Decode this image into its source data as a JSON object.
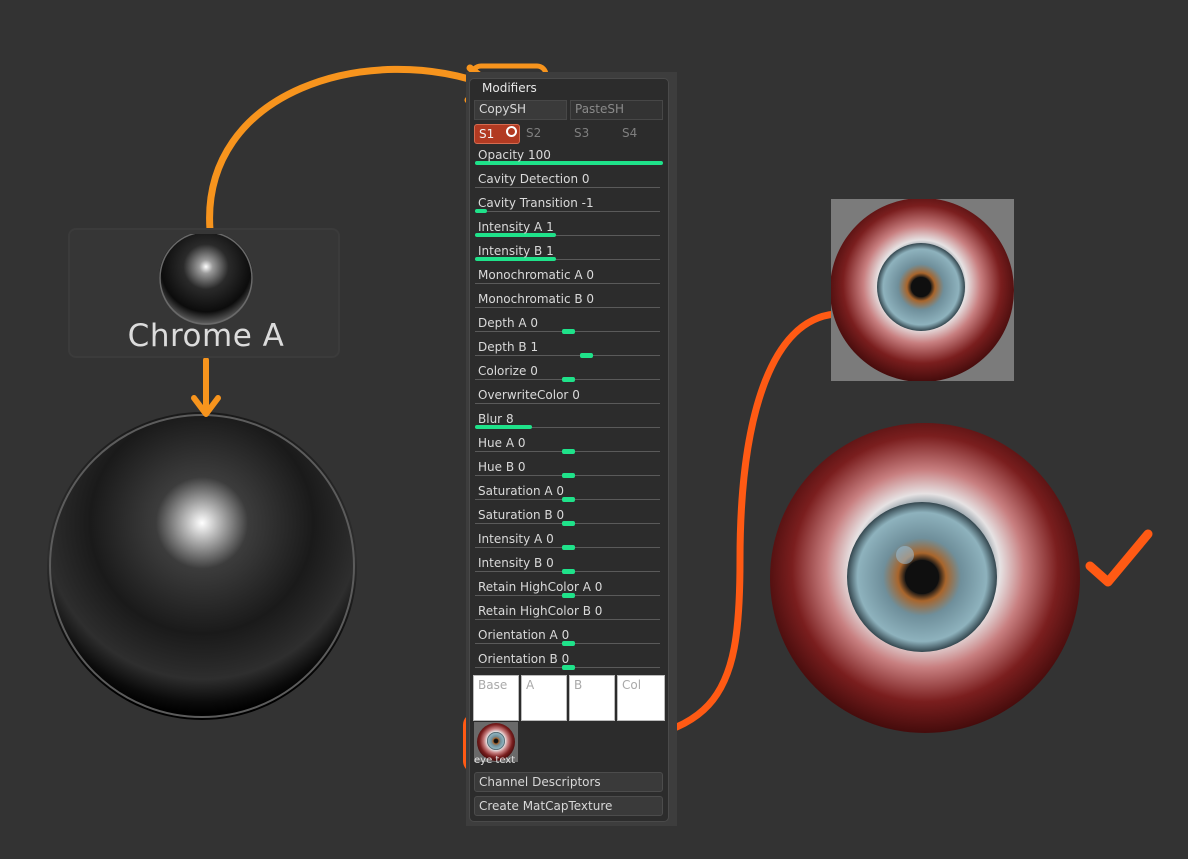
{
  "material": {
    "name": "Chrome A"
  },
  "panel": {
    "title": "Modifiers",
    "copy_sh": "CopySH",
    "paste_sh": "PasteSH",
    "slots": [
      "S1",
      "S2",
      "S3",
      "S4"
    ],
    "sliders": [
      {
        "label": "Opacity",
        "value": "100",
        "level": 1.0,
        "style": "fill"
      },
      {
        "label": "Cavity Detection",
        "value": "0",
        "level": 0.0,
        "style": "none"
      },
      {
        "label": "Cavity Transition",
        "value": "-1",
        "level": 0.04,
        "style": "fill"
      },
      {
        "label": "Intensity A",
        "value": "1",
        "level": 0.44,
        "style": "fill"
      },
      {
        "label": "Intensity B",
        "value": "1",
        "level": 0.44,
        "style": "fill"
      },
      {
        "label": "Monochromatic A",
        "value": "0",
        "level": 0.0,
        "style": "none"
      },
      {
        "label": "Monochromatic B",
        "value": "0",
        "level": 0.0,
        "style": "none"
      },
      {
        "label": "Depth A",
        "value": "0",
        "level": 0.5,
        "style": "knob"
      },
      {
        "label": "Depth B",
        "value": "1",
        "level": 0.6,
        "style": "knob"
      },
      {
        "label": "Colorize",
        "value": "0",
        "level": 0.5,
        "style": "knob"
      },
      {
        "label": "OverwriteColor",
        "value": "0",
        "level": 0.0,
        "style": "none"
      },
      {
        "label": "Blur",
        "value": "8",
        "level": 0.31,
        "style": "fill"
      },
      {
        "label": "Hue A",
        "value": "0",
        "level": 0.5,
        "style": "knob"
      },
      {
        "label": "Hue B",
        "value": "0",
        "level": 0.5,
        "style": "knob"
      },
      {
        "label": "Saturation A",
        "value": "0",
        "level": 0.5,
        "style": "knob"
      },
      {
        "label": "Saturation B",
        "value": "0",
        "level": 0.5,
        "style": "knob"
      },
      {
        "label": "Intensity A",
        "value": "0",
        "level": 0.5,
        "style": "knob"
      },
      {
        "label": "Intensity B",
        "value": "0",
        "level": 0.5,
        "style": "knob"
      },
      {
        "label": "Retain HighColor A",
        "value": "0",
        "level": 0.5,
        "style": "knob"
      },
      {
        "label": "Retain HighColor B",
        "value": "0",
        "level": 0.0,
        "style": "none"
      },
      {
        "label": "Orientation A",
        "value": "0",
        "level": 0.5,
        "style": "knob"
      },
      {
        "label": "Orientation B",
        "value": "0",
        "level": 0.5,
        "style": "knob"
      }
    ],
    "texture_slots": [
      "Base",
      "A",
      "B",
      "Col"
    ],
    "texture_name": "eye text",
    "channel_descriptors": "Channel Descriptors",
    "create_matcap": "Create MatCapTexture"
  },
  "colors": {
    "background": "#333333",
    "slider_accent": "#1fe28a",
    "slot_active": "#b23a22",
    "annotation_orange": "#f7941d",
    "annotation_red_orange": "#ff5a14"
  },
  "icons": [
    "chrome-sphere-icon",
    "checkmark-icon",
    "eye-texture-icon"
  ]
}
